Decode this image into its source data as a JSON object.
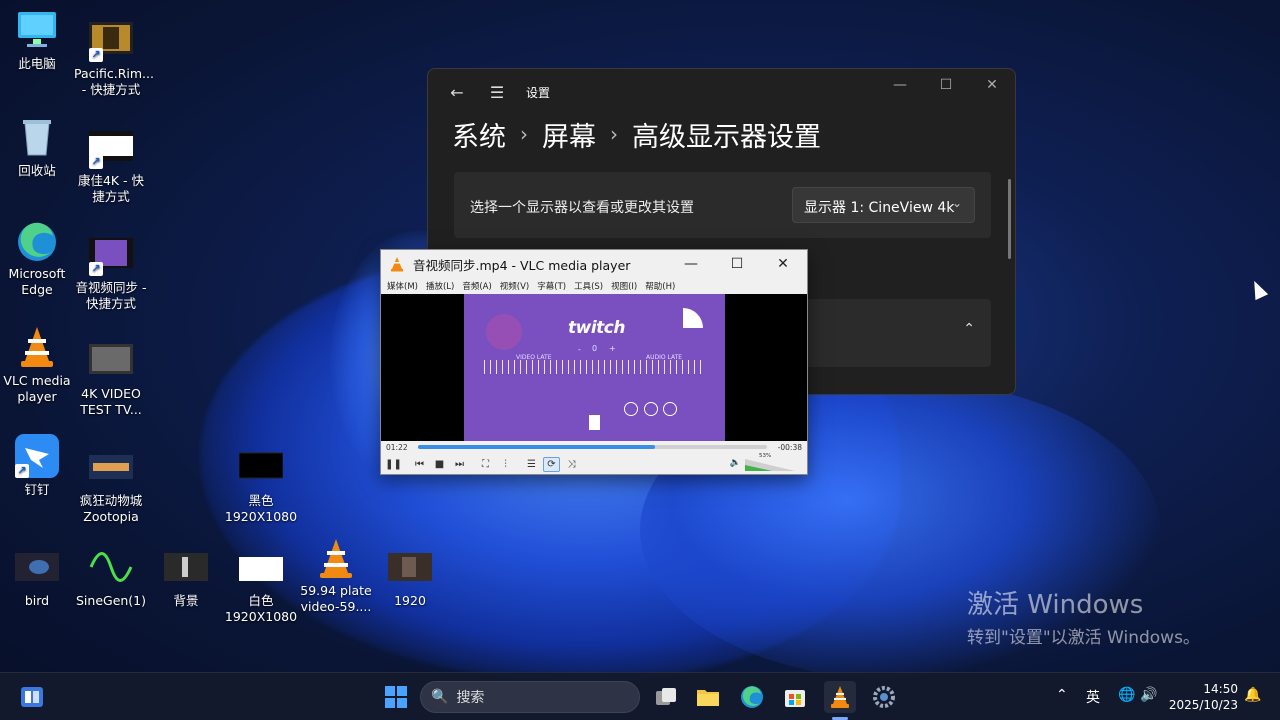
{
  "desktop": {
    "icons": [
      {
        "label": "此电脑"
      },
      {
        "label": "Pacific.Rim...\n- 快捷方式"
      },
      {
        "label": "回收站"
      },
      {
        "label": "康佳4K - 快\n捷方式"
      },
      {
        "label": "Microsoft\nEdge"
      },
      {
        "label": "音视频同步 -\n快捷方式"
      },
      {
        "label": "VLC media\nplayer"
      },
      {
        "label": "4K VIDEO\nTEST TV..."
      },
      {
        "label": "钉钉"
      },
      {
        "label": "疯狂动物城\nZootopia"
      },
      {
        "label": "黑色\n1920X1080"
      },
      {
        "label": "bird"
      },
      {
        "label": "SineGen(1)"
      },
      {
        "label": "背景"
      },
      {
        "label": "白色\n1920X1080"
      },
      {
        "label": "59.94 plate\nvideo-59...."
      },
      {
        "label": "1920"
      }
    ]
  },
  "settings": {
    "title": "设置",
    "breadcrumb": [
      "系统",
      "屏幕",
      "高级显示器设置"
    ],
    "select_label": "选择一个显示器以查看或更改其设置",
    "display_value": "显示器 1: CineView 4k"
  },
  "vlc": {
    "title": "音视频同步.mp4 - VLC media player",
    "menu": [
      "媒体(M)",
      "播放(L)",
      "音频(A)",
      "视频(V)",
      "字幕(T)",
      "工具(S)",
      "视图(I)",
      "帮助(H)"
    ],
    "video": {
      "logo": "twitch",
      "offset": "0",
      "minus": "-",
      "plus": "+",
      "video_late": "VIDEO LATE",
      "audio_late": "AUDIO LATE"
    },
    "time_elapsed": "01:22",
    "time_remaining": "-00:38",
    "progress": 0.68,
    "volume_label": "53%",
    "volume": 0.53
  },
  "activation": {
    "line1": "激活 Windows",
    "line2": "转到\"设置\"以激活 Windows。"
  },
  "taskbar": {
    "search_placeholder": "搜索",
    "ime": "英",
    "time": "14:50",
    "date": "2025/10/23"
  }
}
